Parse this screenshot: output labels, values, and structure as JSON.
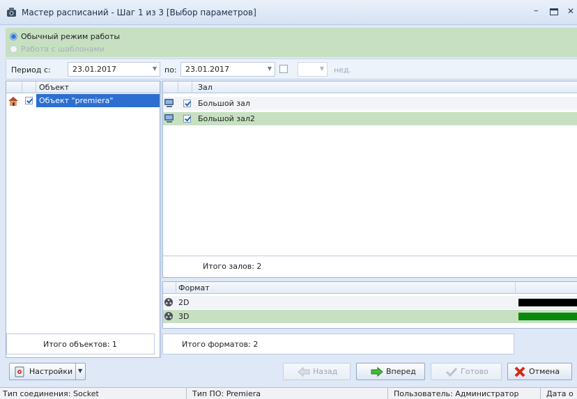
{
  "window": {
    "title": "Мастер расписаний - Шаг 1 из 3 [Выбор параметров]",
    "minimize_glyph": "–",
    "maximize_glyph": "▭",
    "close_glyph": "✕"
  },
  "mode": {
    "options": [
      {
        "label": "Обычный режим работы",
        "selected": true,
        "enabled": true
      },
      {
        "label": "Работа с шаблонами",
        "selected": false,
        "enabled": false
      }
    ]
  },
  "period": {
    "from_label": "Период с:",
    "from_value": "23.01.2017",
    "to_label": "по:",
    "to_value": "23.01.2017",
    "weeks_checkbox_checked": false,
    "weeks_value": "",
    "weeks_label": "нед."
  },
  "objects": {
    "header": "Объект",
    "rows": [
      {
        "label": "Объект \"premiera\"",
        "checked": true,
        "selected": true
      }
    ],
    "total": "Итого объектов: 1"
  },
  "halls": {
    "header": "Зал",
    "rows": [
      {
        "label": "Большой зал",
        "checked": true
      },
      {
        "label": "Большой зал2",
        "checked": true
      }
    ],
    "total": "Итого залов: 2"
  },
  "formats": {
    "header": "Формат",
    "rows": [
      {
        "label": "2D",
        "color": "#000000"
      },
      {
        "label": "3D",
        "color": "#0a8a0a"
      }
    ],
    "total": "Итого форматов: 2"
  },
  "buttons": {
    "settings": "Настройки",
    "back": "Назад",
    "forward": "Вперед",
    "done": "Готово",
    "cancel": "Отмена"
  },
  "status": {
    "connection": "Тип соединения: Socket",
    "software": "Тип ПО: Premiera",
    "user": "Пользователь: Администратор",
    "date": "Дата о"
  },
  "colors": {
    "selection": "#2d6fd1",
    "row_alt": "#c7e0c2",
    "panel_bg": "#dfe8f6"
  }
}
